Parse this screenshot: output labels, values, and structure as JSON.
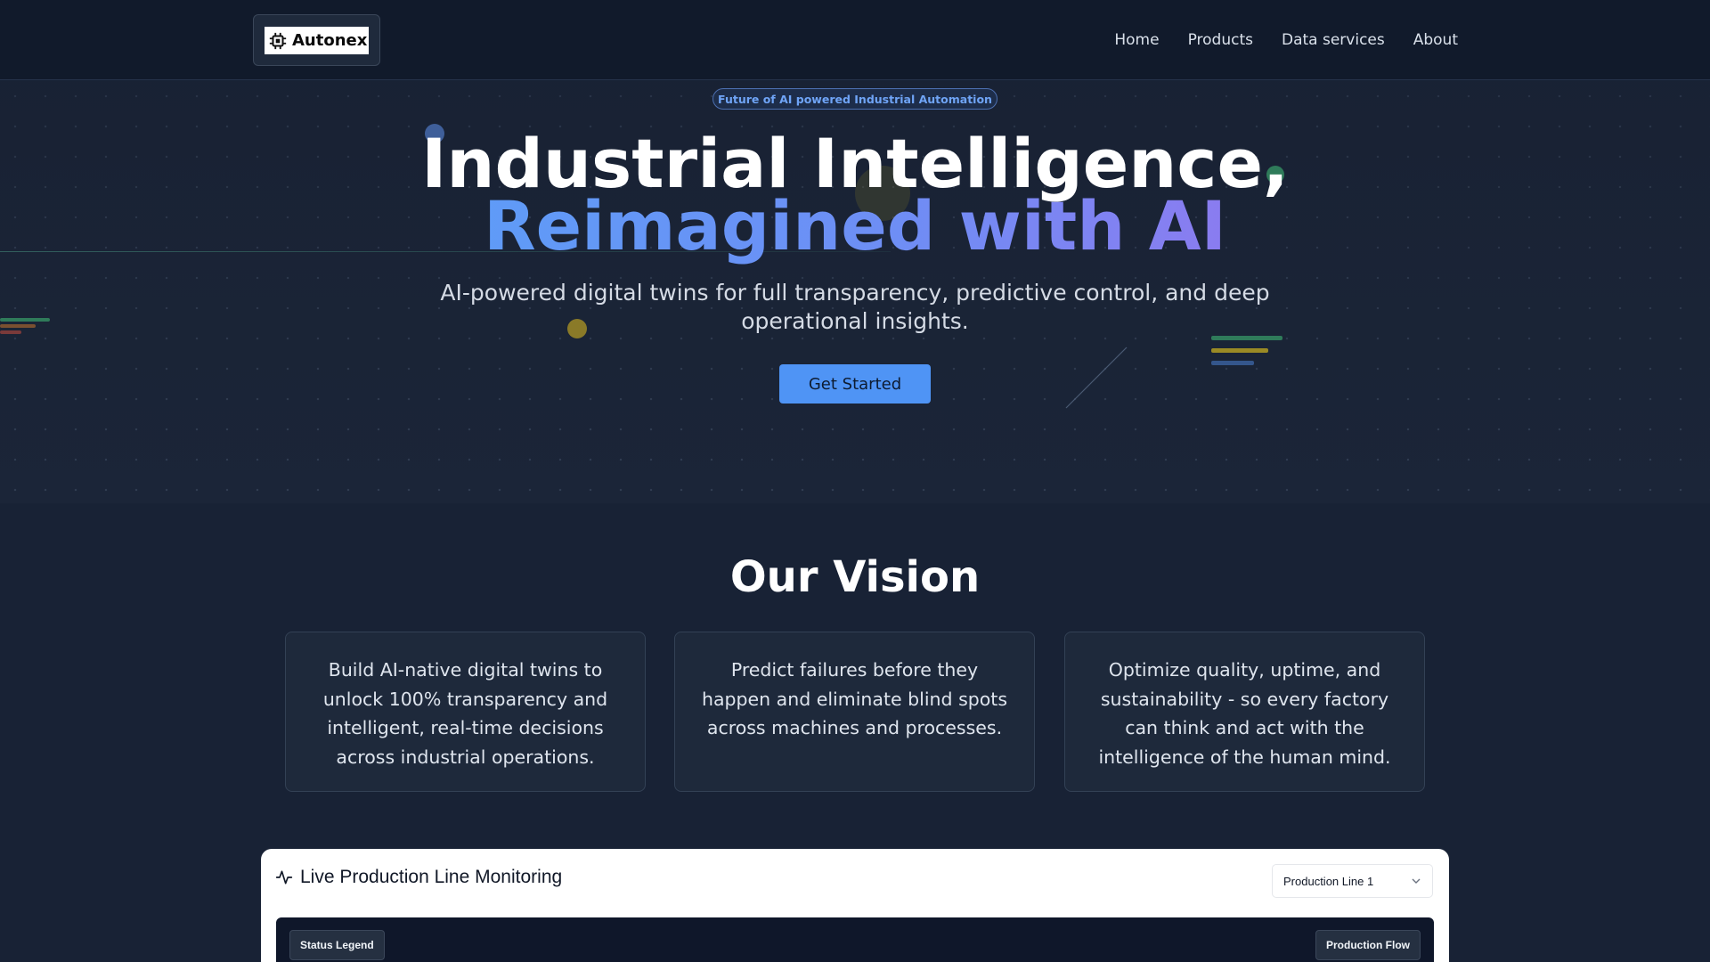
{
  "brand": {
    "name": "Autonex"
  },
  "nav": {
    "links": [
      {
        "label": "Home"
      },
      {
        "label": "Products"
      },
      {
        "label": "Data services"
      },
      {
        "label": "About"
      }
    ]
  },
  "hero": {
    "badge": "Future of AI powered Industrial Automation",
    "title_line1": "Industrial Intelligence,",
    "title_line2": "Reimagined with AI",
    "subtitle": "AI-powered digital twins for full transparency, predictive control, and deep operational insights.",
    "cta": "Get Started"
  },
  "vision": {
    "title": "Our Vision",
    "cards": [
      {
        "text": "Build AI-native digital twins to unlock 100% transparency and intelligent, real-time decisions across industrial operations."
      },
      {
        "text": "Predict failures before they happen and eliminate blind spots across machines and processes."
      },
      {
        "text": "Optimize quality, uptime, and sustainability - so every factory can think and act with the intelligence of the human mind."
      }
    ]
  },
  "monitoring": {
    "title": "Live Production Line Monitoring",
    "select_value": "Production Line 1",
    "legend_label": "Status Legend",
    "flow_label": "Production Flow"
  },
  "colors": {
    "accent": "#4f94f5",
    "gradient_start": "#5f9bf7",
    "gradient_end": "#8a7cf0",
    "page_bg": "#182235",
    "nav_bg": "#111a2b"
  },
  "icons": {
    "logo": "chip-icon",
    "monitoring": "activity-pulse-icon",
    "select": "chevron-down-icon"
  }
}
